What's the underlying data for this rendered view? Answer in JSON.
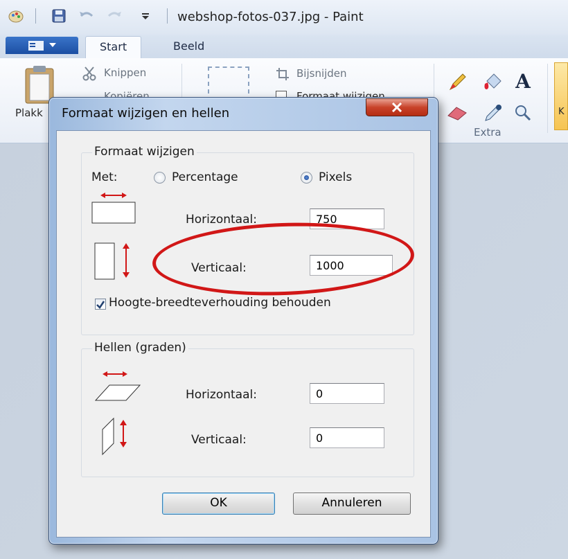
{
  "window": {
    "title": "webshop-fotos-037.jpg - Paint"
  },
  "ribbon": {
    "tabs": [
      {
        "label": "Start"
      },
      {
        "label": "Beeld"
      }
    ],
    "clipboard": {
      "paste_label": "Plakk",
      "cut_label": "Knippen",
      "copy_label": "Kopiëren"
    },
    "image": {
      "crop_label": "Bijsnijden",
      "resize_label": "Formaat wijzigen"
    },
    "tools_group_label": "Extra",
    "colors_label": "K"
  },
  "dialog": {
    "title": "Formaat wijzigen en hellen",
    "resize_group": {
      "title": "Formaat wijzigen",
      "by_label": "Met:",
      "options": [
        {
          "label": "Percentage",
          "checked": false
        },
        {
          "label": "Pixels",
          "checked": true
        }
      ],
      "horizontal_label": "Horizontaal:",
      "horizontal_value": "750",
      "vertical_label": "Verticaal:",
      "vertical_value": "1000",
      "keep_ratio_label": "Hoogte-breedteverhouding behouden",
      "keep_ratio_checked": true
    },
    "skew_group": {
      "title": "Hellen (graden)",
      "horizontal_label": "Horizontaal:",
      "horizontal_value": "0",
      "vertical_label": "Verticaal:",
      "vertical_value": "0"
    },
    "ok_label": "OK",
    "cancel_label": "Annuleren"
  },
  "colors": {
    "highlight": "#d11717",
    "close_button": "#c8432a",
    "accent_arrow": "#d11717"
  }
}
